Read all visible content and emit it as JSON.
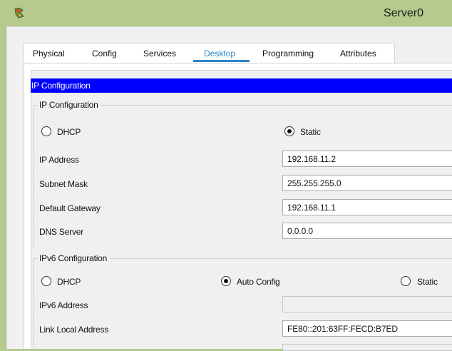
{
  "window": {
    "title": "Server0",
    "icon": "packet-tracer-icon"
  },
  "tabs": [
    {
      "label": "Physical"
    },
    {
      "label": "Config"
    },
    {
      "label": "Services"
    },
    {
      "label": "Desktop",
      "active": true
    },
    {
      "label": "Programming"
    },
    {
      "label": "Attributes"
    }
  ],
  "header": "IP Configuration",
  "ipv4": {
    "legend": "IP Configuration",
    "dhcp_label": "DHCP",
    "static_label": "Static",
    "mode": "Static",
    "ip_label": "IP Address",
    "ip_value": "192.168.11.2",
    "mask_label": "Subnet Mask",
    "mask_value": "255.255.255.0",
    "gateway_label": "Default Gateway",
    "gateway_value": "192.168.11.1",
    "dns_label": "DNS Server",
    "dns_value": "0.0.0.0"
  },
  "ipv6": {
    "legend": "IPv6 Configuration",
    "dhcp_label": "DHCP",
    "auto_label": "Auto Config",
    "static_label": "Static",
    "mode": "Auto Config",
    "addr_label": "IPv6 Address",
    "addr_value": "",
    "link_local_label": "Link Local Address",
    "link_local_value": "FE80::201:63FF:FECD:B7ED"
  },
  "colors": {
    "accent": "#2a86c8",
    "header": "#0000ff",
    "titlebar": "#b5ca8d"
  }
}
